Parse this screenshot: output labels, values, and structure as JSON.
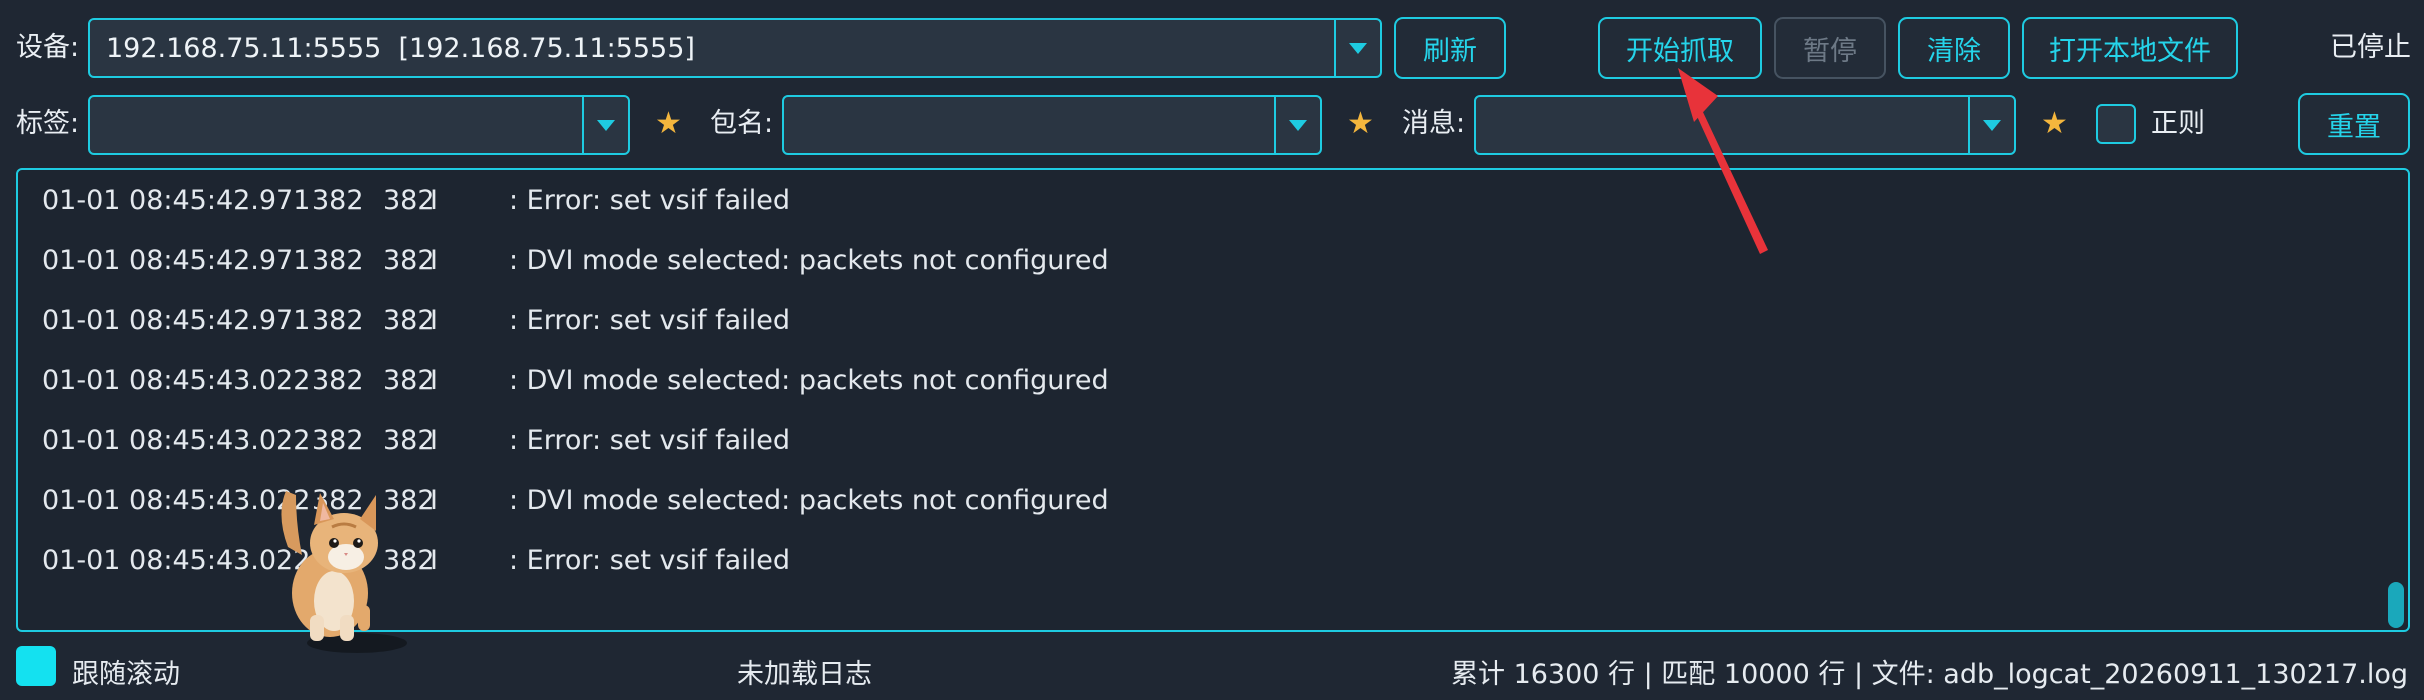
{
  "toolbar": {
    "device_label": "设备:",
    "device_value": "192.168.75.11:5555  [192.168.75.11:5555]",
    "refresh_label": "刷新",
    "start_label": "开始抓取",
    "pause_label": "暂停",
    "clear_label": "清除",
    "open_file_label": "打开本地文件",
    "state_text": "已停止"
  },
  "filters": {
    "tag_label": "标签:",
    "tag_value": "",
    "package_label": "包名:",
    "package_value": "",
    "message_label": "消息:",
    "message_value": "",
    "star_glyph": "★",
    "regex_label": "正则",
    "regex_checked": false,
    "reset_label": "重置"
  },
  "log": {
    "rows": [
      {
        "time": "01-01 08:45:42.971",
        "pid": "382",
        "tid": "382",
        "level": "I",
        "msg": ": Error: set vsif failed"
      },
      {
        "time": "01-01 08:45:42.971",
        "pid": "382",
        "tid": "382",
        "level": "I",
        "msg": ": DVI mode selected: packets not configured"
      },
      {
        "time": "01-01 08:45:42.971",
        "pid": "382",
        "tid": "382",
        "level": "I",
        "msg": ": Error: set vsif failed"
      },
      {
        "time": "01-01 08:45:43.022",
        "pid": "382",
        "tid": "382",
        "level": "I",
        "msg": ": DVI mode selected: packets not configured"
      },
      {
        "time": "01-01 08:45:43.022",
        "pid": "382",
        "tid": "382",
        "level": "I",
        "msg": ": Error: set vsif failed"
      },
      {
        "time": "01-01 08:45:43.022",
        "pid": "382",
        "tid": "382",
        "level": "I",
        "msg": ": DVI mode selected: packets not configured"
      },
      {
        "time": "01-01 08:45:43.022",
        "pid": "382",
        "tid": "382",
        "level": "I",
        "msg": ": Error: set vsif failed"
      }
    ]
  },
  "statusbar": {
    "follow_scroll_label": "跟随滚动",
    "follow_scroll_checked": true,
    "load_status": "未加载日志",
    "stats": "累计 16300 行 | 匹配 10000 行 | 文件: adb_logcat_20260911_130217.log"
  },
  "colors": {
    "accent": "#1ecbe1",
    "background": "#1f2733",
    "star": "#f4b63d",
    "annotation_arrow": "#e8333a"
  },
  "icons": {
    "dropdown": "chevron-down-icon",
    "star": "star-icon",
    "overlay": "cat-sticker",
    "annotation": "red-arrow"
  }
}
